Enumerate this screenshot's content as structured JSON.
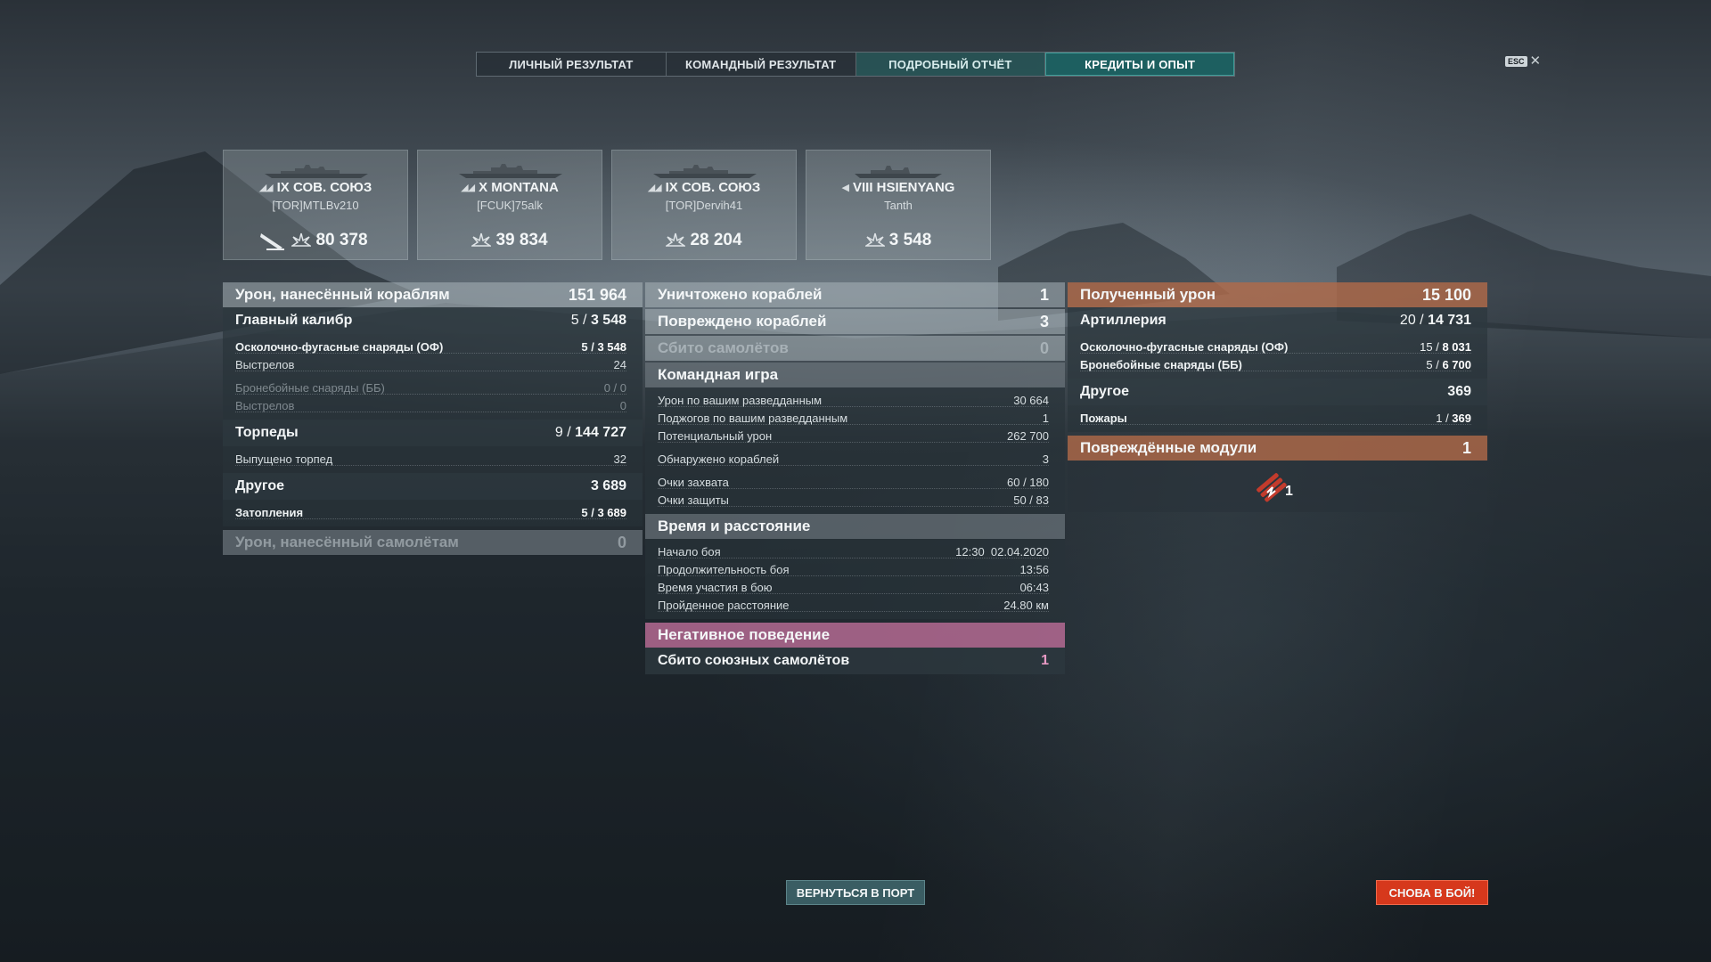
{
  "tabs": [
    {
      "label": "ЛИЧНЫЙ РЕЗУЛЬТАТ"
    },
    {
      "label": "КОМАНДНЫЙ РЕЗУЛЬТАТ"
    },
    {
      "label": "ПОДРОБНЫЙ ОТЧЁТ"
    },
    {
      "label": "КРЕДИТЫ И ОПЫТ"
    }
  ],
  "esc": {
    "key": "ESC",
    "close": "✕"
  },
  "ships": [
    {
      "rank": "◢◢",
      "name": "IX СОВ. СОЮЗ",
      "player": "[TOR]MTLBv210",
      "damage": "80 378"
    },
    {
      "rank": "◢◢",
      "name": "X MONTANA",
      "player": "[FCUK]75alk",
      "damage": "39 834"
    },
    {
      "rank": "◢◢",
      "name": "IX СОВ. СОЮЗ",
      "player": "[TOR]Dervih41",
      "damage": "28 204"
    },
    {
      "rank": "◀",
      "name": "VIII HSIENYANG",
      "player": "Tanth",
      "damage": "3 548"
    }
  ],
  "left": {
    "damage_ships": {
      "label": "Урон, нанесённый кораблям",
      "value": "151 964"
    },
    "main_battery": {
      "label": "Главный калибр",
      "hits": "5",
      "value": "3 548"
    },
    "he_shells": {
      "label": "Осколочно-фугасные снаряды (ОФ)",
      "hits": "5",
      "value": "3 548"
    },
    "he_shots": {
      "label": "Выстрелов",
      "value": "24"
    },
    "ap_shells": {
      "label": "Бронебойные снаряды (ББ)",
      "value": "0 / 0"
    },
    "ap_shots": {
      "label": "Выстрелов",
      "value": "0"
    },
    "torpedoes": {
      "label": "Торпеды",
      "hits": "9",
      "value": "144 727"
    },
    "torps_fired": {
      "label": "Выпущено торпед",
      "value": "32"
    },
    "other": {
      "label": "Другое",
      "value": "3 689"
    },
    "flooding": {
      "label": "Затопления",
      "hits": "5",
      "value": "3 689"
    },
    "damage_planes": {
      "label": "Урон, нанесённый самолётам",
      "value": "0"
    }
  },
  "mid": {
    "destroyed": {
      "label": "Уничтожено кораблей",
      "value": "1"
    },
    "damaged": {
      "label": "Повреждено кораблей",
      "value": "3"
    },
    "planes_shot": {
      "label": "Сбито самолётов",
      "value": "0"
    },
    "team_play": {
      "label": "Командная игра"
    },
    "spotting_damage": {
      "label": "Урон по вашим разведданным",
      "value": "30 664"
    },
    "spotting_fires": {
      "label": "Поджогов по вашим разведданным",
      "value": "1"
    },
    "potential": {
      "label": "Потенциальный урон",
      "value": "262 700"
    },
    "spotted": {
      "label": "Обнаружено кораблей",
      "value": "3"
    },
    "capture": {
      "label": "Очки захвата",
      "value": "60 / 180"
    },
    "defense": {
      "label": "Очки защиты",
      "value": "50 / 83"
    },
    "time_distance": {
      "label": "Время и расстояние"
    },
    "battle_start": {
      "label": "Начало боя",
      "value": "12:30  02.04.2020"
    },
    "duration": {
      "label": "Продолжительность боя",
      "value": "13:56"
    },
    "participation": {
      "label": "Время участия в бою",
      "value": "06:43"
    },
    "distance": {
      "label": "Пройденное расстояние",
      "value": "24.80 км"
    },
    "negative": {
      "label": "Негативное поведение"
    },
    "allied_planes": {
      "label": "Сбито союзных самолётов",
      "value": "1"
    }
  },
  "right": {
    "received": {
      "label": "Полученный урон",
      "value": "15 100"
    },
    "artillery": {
      "label": "Артиллерия",
      "hits": "20",
      "value": "14 731"
    },
    "he_in": {
      "label": "Осколочно-фугасные снаряды (ОФ)",
      "hits": "15",
      "value": "8 031"
    },
    "ap_in": {
      "label": "Бронебойные снаряды (ББ)",
      "hits": "5",
      "value": "6 700"
    },
    "other": {
      "label": "Другое",
      "value": "369"
    },
    "fires": {
      "label": "Пожары",
      "hits": "1",
      "value": "369"
    },
    "modules": {
      "label": "Повреждённые модули",
      "value": "1"
    },
    "module_count": "1"
  },
  "buttons": {
    "port": "ВЕРНУТЬСЯ В ПОРТ",
    "battle": "СНОВА В БОЙ!"
  },
  "colors": {
    "accent_teal": "#1c6262",
    "received_orange": "#b26a48",
    "negative_pink": "#b96c96",
    "battle_red": "#d6381c"
  }
}
